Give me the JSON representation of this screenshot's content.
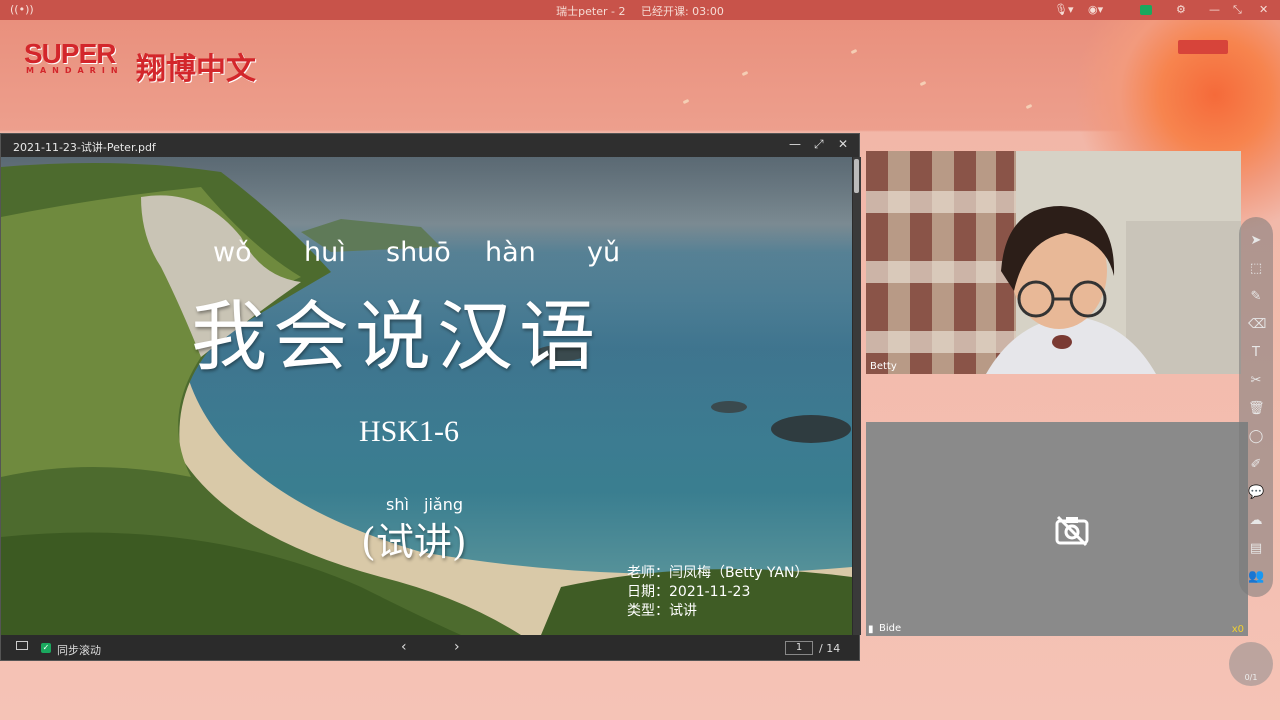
{
  "titlebar": {
    "room": "瑞士peter - 2",
    "status": "已经开课: 03:00"
  },
  "logo": {
    "text_en": "SUPER",
    "text_sub": "MANDARIN",
    "text_cn": "翔博中文"
  },
  "pdf": {
    "filename": "2021-11-23-试讲-Peter.pdf",
    "sync_label": "同步滚动",
    "page_current": "1",
    "page_total": "/ 14"
  },
  "slide": {
    "pinyin": [
      "wǒ",
      "huì",
      "shuō",
      "hàn",
      "yǔ"
    ],
    "title": "我会说汉语",
    "level": "HSK1-6",
    "sub_pinyin": [
      "shì",
      "jiǎng"
    ],
    "sub_title": "(试讲)",
    "teacher": "老师：闫凤梅（Betty YAN）",
    "date": "日期：2021-11-23",
    "type": "类型：试讲"
  },
  "videos": {
    "teacher_name": "Betty",
    "student_name": "Bide",
    "trophy": "x0"
  },
  "counter": "0/1",
  "colors": {
    "titlebar": "#c8534a",
    "brand_red": "#d3262b",
    "check_green": "#1aa85e"
  }
}
